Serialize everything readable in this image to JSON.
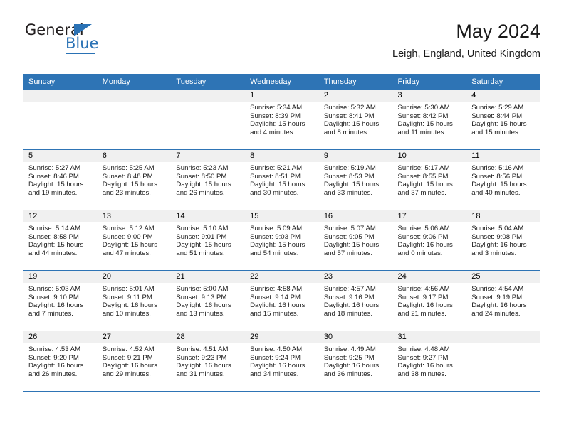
{
  "brand": {
    "name_top": "General",
    "name_bottom": "Blue",
    "accent_color": "#2a72b5"
  },
  "header": {
    "title": "May 2024",
    "subtitle": "Leigh, England, United Kingdom",
    "header_bg_color": "#2e74b5",
    "daynum_bg_color": "#f0f0f0"
  },
  "weekdays": [
    "Sunday",
    "Monday",
    "Tuesday",
    "Wednesday",
    "Thursday",
    "Friday",
    "Saturday"
  ],
  "labels": {
    "sunrise_prefix": "Sunrise:",
    "sunset_prefix": "Sunset:",
    "daylight_prefix": "Daylight:"
  },
  "weeks": [
    [
      {
        "day": "",
        "empty": true
      },
      {
        "day": "",
        "empty": true
      },
      {
        "day": "",
        "empty": true
      },
      {
        "day": "1",
        "sunrise": "Sunrise: 5:34 AM",
        "sunset": "Sunset: 8:39 PM",
        "daylight_1": "Daylight: 15 hours",
        "daylight_2": "and 4 minutes."
      },
      {
        "day": "2",
        "sunrise": "Sunrise: 5:32 AM",
        "sunset": "Sunset: 8:41 PM",
        "daylight_1": "Daylight: 15 hours",
        "daylight_2": "and 8 minutes."
      },
      {
        "day": "3",
        "sunrise": "Sunrise: 5:30 AM",
        "sunset": "Sunset: 8:42 PM",
        "daylight_1": "Daylight: 15 hours",
        "daylight_2": "and 11 minutes."
      },
      {
        "day": "4",
        "sunrise": "Sunrise: 5:29 AM",
        "sunset": "Sunset: 8:44 PM",
        "daylight_1": "Daylight: 15 hours",
        "daylight_2": "and 15 minutes."
      }
    ],
    [
      {
        "day": "5",
        "sunrise": "Sunrise: 5:27 AM",
        "sunset": "Sunset: 8:46 PM",
        "daylight_1": "Daylight: 15 hours",
        "daylight_2": "and 19 minutes."
      },
      {
        "day": "6",
        "sunrise": "Sunrise: 5:25 AM",
        "sunset": "Sunset: 8:48 PM",
        "daylight_1": "Daylight: 15 hours",
        "daylight_2": "and 23 minutes."
      },
      {
        "day": "7",
        "sunrise": "Sunrise: 5:23 AM",
        "sunset": "Sunset: 8:50 PM",
        "daylight_1": "Daylight: 15 hours",
        "daylight_2": "and 26 minutes."
      },
      {
        "day": "8",
        "sunrise": "Sunrise: 5:21 AM",
        "sunset": "Sunset: 8:51 PM",
        "daylight_1": "Daylight: 15 hours",
        "daylight_2": "and 30 minutes."
      },
      {
        "day": "9",
        "sunrise": "Sunrise: 5:19 AM",
        "sunset": "Sunset: 8:53 PM",
        "daylight_1": "Daylight: 15 hours",
        "daylight_2": "and 33 minutes."
      },
      {
        "day": "10",
        "sunrise": "Sunrise: 5:17 AM",
        "sunset": "Sunset: 8:55 PM",
        "daylight_1": "Daylight: 15 hours",
        "daylight_2": "and 37 minutes."
      },
      {
        "day": "11",
        "sunrise": "Sunrise: 5:16 AM",
        "sunset": "Sunset: 8:56 PM",
        "daylight_1": "Daylight: 15 hours",
        "daylight_2": "and 40 minutes."
      }
    ],
    [
      {
        "day": "12",
        "sunrise": "Sunrise: 5:14 AM",
        "sunset": "Sunset: 8:58 PM",
        "daylight_1": "Daylight: 15 hours",
        "daylight_2": "and 44 minutes."
      },
      {
        "day": "13",
        "sunrise": "Sunrise: 5:12 AM",
        "sunset": "Sunset: 9:00 PM",
        "daylight_1": "Daylight: 15 hours",
        "daylight_2": "and 47 minutes."
      },
      {
        "day": "14",
        "sunrise": "Sunrise: 5:10 AM",
        "sunset": "Sunset: 9:01 PM",
        "daylight_1": "Daylight: 15 hours",
        "daylight_2": "and 51 minutes."
      },
      {
        "day": "15",
        "sunrise": "Sunrise: 5:09 AM",
        "sunset": "Sunset: 9:03 PM",
        "daylight_1": "Daylight: 15 hours",
        "daylight_2": "and 54 minutes."
      },
      {
        "day": "16",
        "sunrise": "Sunrise: 5:07 AM",
        "sunset": "Sunset: 9:05 PM",
        "daylight_1": "Daylight: 15 hours",
        "daylight_2": "and 57 minutes."
      },
      {
        "day": "17",
        "sunrise": "Sunrise: 5:06 AM",
        "sunset": "Sunset: 9:06 PM",
        "daylight_1": "Daylight: 16 hours",
        "daylight_2": "and 0 minutes."
      },
      {
        "day": "18",
        "sunrise": "Sunrise: 5:04 AM",
        "sunset": "Sunset: 9:08 PM",
        "daylight_1": "Daylight: 16 hours",
        "daylight_2": "and 3 minutes."
      }
    ],
    [
      {
        "day": "19",
        "sunrise": "Sunrise: 5:03 AM",
        "sunset": "Sunset: 9:10 PM",
        "daylight_1": "Daylight: 16 hours",
        "daylight_2": "and 7 minutes."
      },
      {
        "day": "20",
        "sunrise": "Sunrise: 5:01 AM",
        "sunset": "Sunset: 9:11 PM",
        "daylight_1": "Daylight: 16 hours",
        "daylight_2": "and 10 minutes."
      },
      {
        "day": "21",
        "sunrise": "Sunrise: 5:00 AM",
        "sunset": "Sunset: 9:13 PM",
        "daylight_1": "Daylight: 16 hours",
        "daylight_2": "and 13 minutes."
      },
      {
        "day": "22",
        "sunrise": "Sunrise: 4:58 AM",
        "sunset": "Sunset: 9:14 PM",
        "daylight_1": "Daylight: 16 hours",
        "daylight_2": "and 15 minutes."
      },
      {
        "day": "23",
        "sunrise": "Sunrise: 4:57 AM",
        "sunset": "Sunset: 9:16 PM",
        "daylight_1": "Daylight: 16 hours",
        "daylight_2": "and 18 minutes."
      },
      {
        "day": "24",
        "sunrise": "Sunrise: 4:56 AM",
        "sunset": "Sunset: 9:17 PM",
        "daylight_1": "Daylight: 16 hours",
        "daylight_2": "and 21 minutes."
      },
      {
        "day": "25",
        "sunrise": "Sunrise: 4:54 AM",
        "sunset": "Sunset: 9:19 PM",
        "daylight_1": "Daylight: 16 hours",
        "daylight_2": "and 24 minutes."
      }
    ],
    [
      {
        "day": "26",
        "sunrise": "Sunrise: 4:53 AM",
        "sunset": "Sunset: 9:20 PM",
        "daylight_1": "Daylight: 16 hours",
        "daylight_2": "and 26 minutes."
      },
      {
        "day": "27",
        "sunrise": "Sunrise: 4:52 AM",
        "sunset": "Sunset: 9:21 PM",
        "daylight_1": "Daylight: 16 hours",
        "daylight_2": "and 29 minutes."
      },
      {
        "day": "28",
        "sunrise": "Sunrise: 4:51 AM",
        "sunset": "Sunset: 9:23 PM",
        "daylight_1": "Daylight: 16 hours",
        "daylight_2": "and 31 minutes."
      },
      {
        "day": "29",
        "sunrise": "Sunrise: 4:50 AM",
        "sunset": "Sunset: 9:24 PM",
        "daylight_1": "Daylight: 16 hours",
        "daylight_2": "and 34 minutes."
      },
      {
        "day": "30",
        "sunrise": "Sunrise: 4:49 AM",
        "sunset": "Sunset: 9:25 PM",
        "daylight_1": "Daylight: 16 hours",
        "daylight_2": "and 36 minutes."
      },
      {
        "day": "31",
        "sunrise": "Sunrise: 4:48 AM",
        "sunset": "Sunset: 9:27 PM",
        "daylight_1": "Daylight: 16 hours",
        "daylight_2": "and 38 minutes."
      },
      {
        "day": "",
        "empty": true
      }
    ]
  ]
}
